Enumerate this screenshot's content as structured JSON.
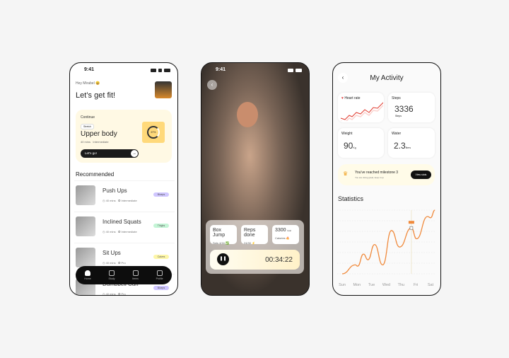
{
  "home": {
    "time": "9:41",
    "greeting": "Hey Mirabel 😄",
    "title": "Let’s get fit!",
    "continue": {
      "label": "Continue",
      "tag": "Stretch",
      "workout": "Upper body",
      "duration": "40 mins",
      "level": "Intermediate",
      "progress": "67%",
      "cta": "Let's go!"
    },
    "recommended_title": "Recommended",
    "items": [
      {
        "name": "Push Ups",
        "duration": "40 mins",
        "level": "Intermediate",
        "tag": "Biceps",
        "tag_color": "#cfc6ff"
      },
      {
        "name": "Inclined Squats",
        "duration": "40 mins",
        "level": "Intermediate",
        "tag": "Thighs",
        "tag_color": "#c4f5d6"
      },
      {
        "name": "Sit Ups",
        "duration": "40 mins",
        "level": "Pro",
        "tag": "Calves",
        "tag_color": "#fdf6a8"
      },
      {
        "name": "Dumbbell Curl",
        "duration": "40 mins",
        "level": "Pro",
        "tag": "Biceps",
        "tag_color": "#cfc6ff"
      }
    ],
    "nav": [
      {
        "label": "Home",
        "icon": "home-icon"
      },
      {
        "label": "Study",
        "icon": "calendar-icon"
      },
      {
        "label": "Items",
        "icon": "dots-icon"
      },
      {
        "label": "Profile",
        "icon": "user-icon"
      }
    ]
  },
  "workout": {
    "time": "9:41",
    "stats": [
      {
        "title": "Box Jump",
        "sub": "Sets 4/16 ✅"
      },
      {
        "title": "Reps done",
        "sub": "24/30 ⚡"
      },
      {
        "title": "3300",
        "unit": "kcal",
        "sub": "Calories 🔥"
      }
    ],
    "timer": "00:34:22"
  },
  "activity": {
    "title": "My Activity",
    "heart": {
      "label": "Heart rate"
    },
    "steps": {
      "label": "Steps",
      "value": "3336",
      "unit": "Steps"
    },
    "weight": {
      "label": "Weight",
      "value": "90",
      "unit": "Kg"
    },
    "water": {
      "label": "Water",
      "value": "2.3",
      "unit": "liters"
    },
    "milestone": {
      "title": "You've reached milestone 3",
      "sub": "You are doing great, keep it up",
      "cta": "View stats"
    },
    "stats_title": "Statistics"
  },
  "chart_data": {
    "type": "line",
    "categories": [
      "Sun",
      "Mon",
      "Tue",
      "Wed",
      "Thu",
      "Fri",
      "Sat"
    ],
    "points": [
      [
        0,
        0
      ],
      [
        0.9,
        14
      ],
      [
        1.05,
        12
      ],
      [
        1.45,
        31
      ],
      [
        1.75,
        22
      ],
      [
        2.2,
        46
      ],
      [
        2.75,
        14
      ],
      [
        3.35,
        68
      ],
      [
        3.9,
        42
      ],
      [
        4.7,
        72
      ],
      [
        5.05,
        55
      ],
      [
        5.8,
        90
      ],
      [
        6.0,
        88
      ],
      [
        6.3,
        100
      ]
    ],
    "highlight_x": 4.7,
    "grid": true,
    "line_color": "#f08a3c"
  }
}
